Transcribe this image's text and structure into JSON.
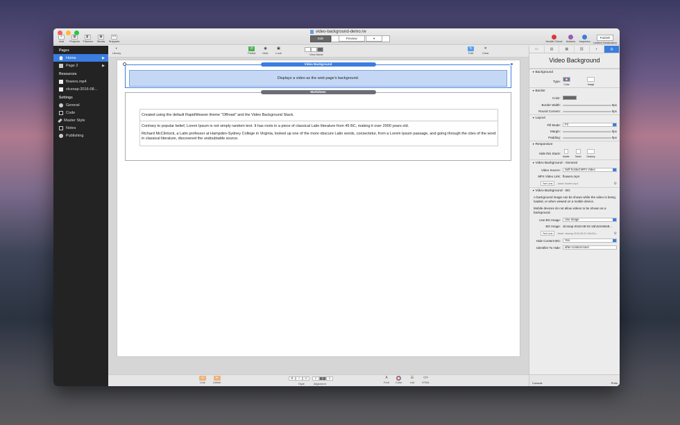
{
  "window": {
    "title": "video-background-demo.rw"
  },
  "toolbar": {
    "left": [
      {
        "label": "Add",
        "icon": "+"
      },
      {
        "label": "Projects",
        "icon": "▦"
      },
      {
        "label": "Themes",
        "icon": "◧"
      },
      {
        "label": "Media",
        "icon": "▣"
      },
      {
        "label": "Snippets",
        "icon": "<>"
      }
    ],
    "mode_edit": "Edit",
    "mode_preview": "Preview",
    "preview_arrow": "▾",
    "right": [
      {
        "label": "Health Check",
        "color": "#d9383a"
      },
      {
        "label": "Addons",
        "color": "#9b59b6"
      },
      {
        "label": "Inspector",
        "color": "#3b7de0"
      }
    ],
    "publish_label": "Publish",
    "publish_caption": "Limited Destination"
  },
  "sidebar": {
    "pages_head": "Pages",
    "pages": [
      {
        "label": "Home",
        "active": true
      },
      {
        "label": "Page 2",
        "active": false
      }
    ],
    "resources_head": "Resources",
    "resources": [
      {
        "label": "flowers.mp4"
      },
      {
        "label": "vlcsnap-2016-08..."
      }
    ],
    "settings_head": "Settings",
    "settings": [
      {
        "label": "General"
      },
      {
        "label": "Code"
      },
      {
        "label": "Master Style"
      },
      {
        "label": "Notes"
      },
      {
        "label": "Publishing"
      }
    ]
  },
  "canvas_toolbar": {
    "library": "Library",
    "partial": "Partial",
    "hide": "Hide",
    "lock": "Lock",
    "view_mode": "View Mode",
    "edit": "Edit",
    "clear": "Clear"
  },
  "canvas": {
    "video_stack_label": "Video Background",
    "video_stack_text": "Displays a video as the web page's background.",
    "markdown_stack_label": "Markdown",
    "md_line1": "Created using the default RapidWeaver theme \"Offroad\" and the Video Background Stack.",
    "md_p1": "Contrary to popular belief, Lorem Ipsum is not simply random text. It has roots in a piece of classical Latin literature from 45 BC, making it over 2000 years old.",
    "md_p2": "Richard McClintock, a Latin professor at Hampden-Sydney College in Virginia, looked up one of the more obscure Latin words, consectetur, from a Lorem Ipsum passage, and going through the cites of the word in classical literature, discovered the undoubtable source."
  },
  "formatbar": {
    "link": "Link",
    "unlink": "Unlink",
    "style": "Style",
    "alignment": "Alignment",
    "font": "Font",
    "color": "Color",
    "list": "List",
    "html": "HTML",
    "bold": "B",
    "italic": "I",
    "underline": "U"
  },
  "inspector": {
    "title": "Video Background",
    "sec_background": "Background",
    "type_label": "Type:",
    "type_color": "Color",
    "type_image": "Image",
    "sec_border": "Border",
    "color_label": "Color:",
    "border_width_label": "Border Width:",
    "border_width_val": "0px",
    "round_corners_label": "Round Corners:",
    "round_corners_val": "0px",
    "sec_layout": "Layout",
    "fill_mode_label": "Fill Mode:",
    "fill_mode_val": "Fit",
    "margin_label": "Margin:",
    "margin_val": "0px",
    "padding_label": "Padding:",
    "padding_val": "0px",
    "sec_responsive": "Responsive",
    "hide_stack_label": "Hide this Stack:",
    "mobile": "Mobile",
    "tablet": "Tablet",
    "desktop": "Desktop",
    "sec_vb_general": "Video Background - General",
    "video_source_label": "Video Source:",
    "video_source_val": "Self-hosted MP4 Video",
    "mp4_link_label": "MP4 Video Link:",
    "mp4_link_val": "flowers.mp4",
    "set_link": "Set Link",
    "mp4_link_path": "Asset: flowers.mp4",
    "sec_vb_bg": "Video Background - BG",
    "bg_desc1": "A background image can be shown while the video is being loaded, or when viewed on a mobile device.",
    "bg_desc2": "Mobile devices do not allow videos to be shown as a background.",
    "use_bg_label": "Use BG Image:",
    "use_bg_val": "Use image",
    "bg_image_label": "BG Image:",
    "bg_image_val": "vlcsnap-2016-08-02-16h42m56s8...",
    "bg_image_path": "Asset: vlcsnap-2016-08-02-16h42m...",
    "hide_content_label": "Hide Content BG:",
    "hide_content_val": "Yes",
    "identifier_label": "Identifier To Hide:",
    "identifier_val": "after-content-inner",
    "console": "Console",
    "prefs": "Prefs"
  }
}
